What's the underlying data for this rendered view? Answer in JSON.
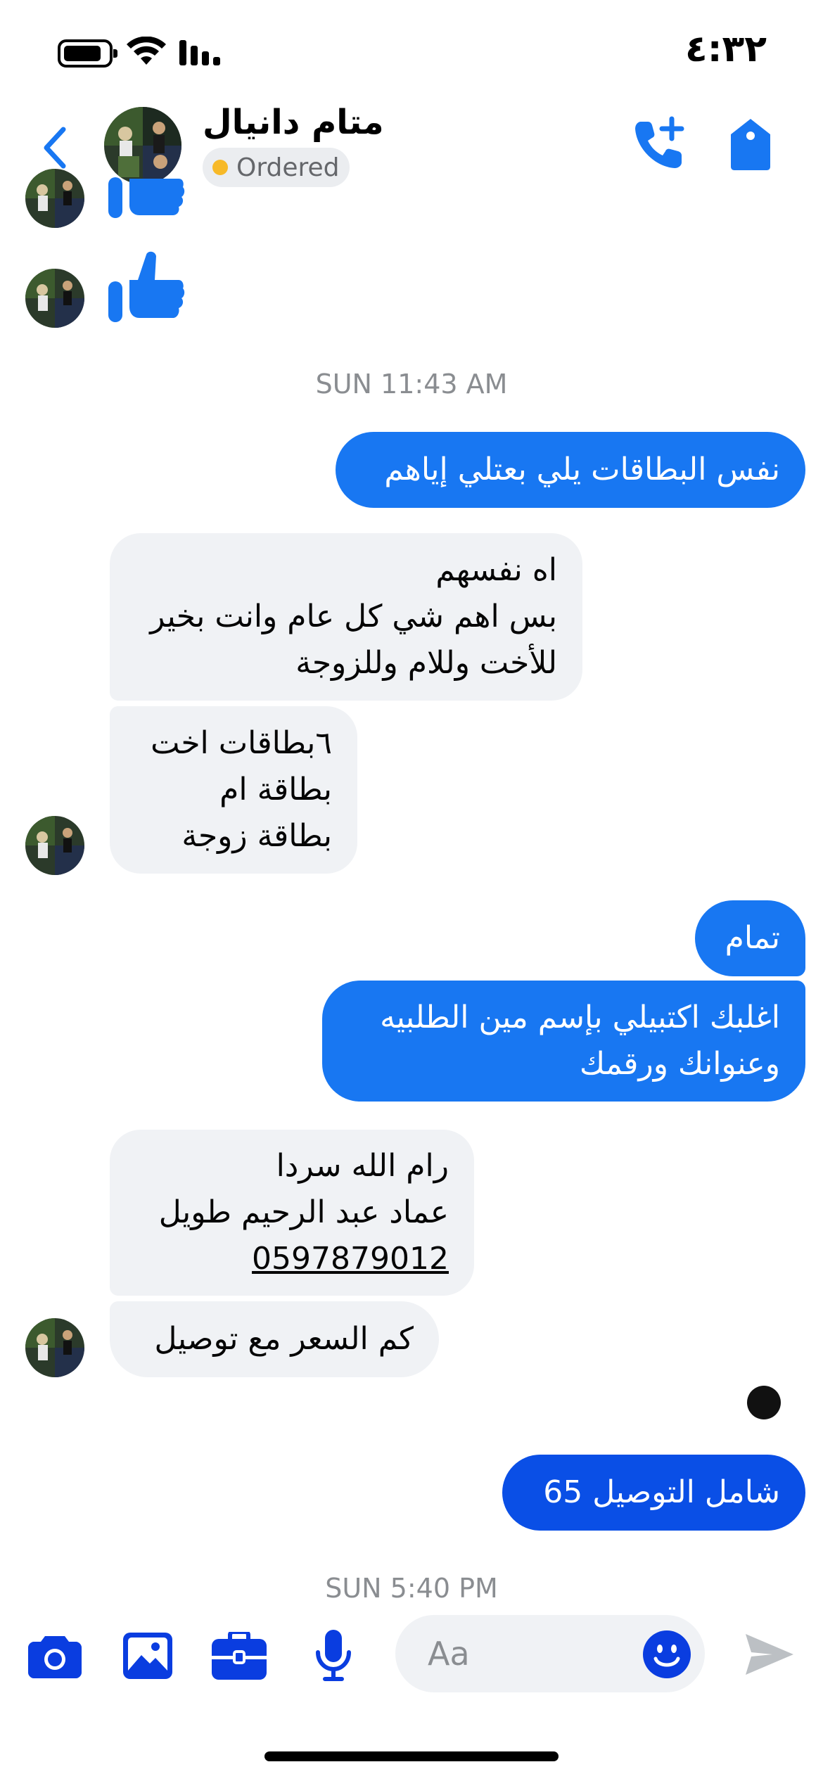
{
  "status_bar": {
    "time": "٤:٣٢"
  },
  "header": {
    "contact_name": "متام دانيال",
    "order_status": "Ordered",
    "status_dot_color": "#f7b928",
    "icons": [
      "back-chevron-icon",
      "add-call-icon",
      "tag-icon"
    ]
  },
  "thread": {
    "timestamps": [
      "SUN 11:43 AM",
      "SUN 5:40 PM"
    ],
    "messages": [
      {
        "from": "contact",
        "type": "sticker",
        "icon": "thumbs-up-icon"
      },
      {
        "from": "contact",
        "type": "sticker",
        "icon": "thumbs-up-icon"
      },
      {
        "from": "me",
        "lines": [
          "نفس البطاقات يلي بعتلي إياهم"
        ]
      },
      {
        "from": "contact",
        "lines": [
          "اه نفسهم",
          "بس اهم شي كل عام وانت بخير",
          "للأخت وللام وللزوجة"
        ]
      },
      {
        "from": "contact",
        "lines": [
          "٦بطاقات اخت",
          "بطاقة ام",
          "بطاقة زوجة"
        ]
      },
      {
        "from": "me",
        "lines": [
          "تمام"
        ]
      },
      {
        "from": "me",
        "lines": [
          "اغلبك اكتبيلي بإسم مين الطلبيه",
          "وعنوانك ورقمك"
        ]
      },
      {
        "from": "contact",
        "lines": [
          "رام الله سردا",
          "عماد عبد الرحيم طويل",
          "0597879012"
        ]
      },
      {
        "from": "contact",
        "lines": [
          "كم السعر مع توصيل"
        ]
      },
      {
        "from": "me",
        "lines": [
          "65 شامل التوصيل"
        ]
      }
    ]
  },
  "composer": {
    "placeholder": "Aa",
    "icons": [
      "camera-icon",
      "photo-icon",
      "briefcase-icon",
      "microphone-icon",
      "emoji-icon",
      "send-icon"
    ]
  },
  "colors": {
    "accent": "#1877f2",
    "outgoing_dark": "#0a4fe6",
    "incoming_bg": "#f0f2f5",
    "composer_icons": "#0a3de0"
  }
}
